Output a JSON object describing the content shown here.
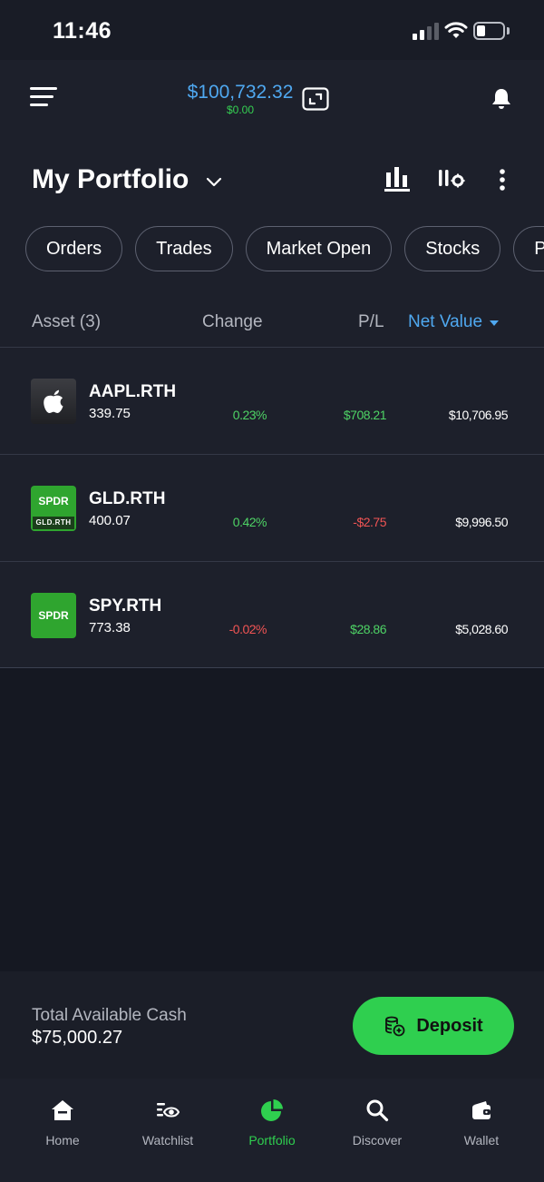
{
  "status_bar": {
    "time": "11:46"
  },
  "header": {
    "balance": "$100,732.32",
    "balance_change": "$0.00",
    "title": "My Portfolio"
  },
  "filters": [
    "Orders",
    "Trades",
    "Market Open",
    "Stocks",
    "P"
  ],
  "columns": {
    "asset": "Asset (3)",
    "change": "Change",
    "pl": "P/L",
    "net_value": "Net Value"
  },
  "assets": [
    {
      "ticker": "AAPL.RTH",
      "price": "339.75",
      "change": "0.23%",
      "change_dir": "pos",
      "pl": "$708.21",
      "pl_dir": "pos",
      "net_value": "$10,706.95",
      "logo": "apple-logo-icon"
    },
    {
      "ticker": "GLD.RTH",
      "price": "400.07",
      "change": "0.42%",
      "change_dir": "pos",
      "pl": "-$2.75",
      "pl_dir": "neg",
      "net_value": "$9,996.50",
      "logo": "spdr-gld-logo",
      "logo_text": "SPDR",
      "logo_sub": "GLD.RTH"
    },
    {
      "ticker": "SPY.RTH",
      "price": "773.38",
      "change": "-0.02%",
      "change_dir": "neg",
      "pl": "$28.86",
      "pl_dir": "pos",
      "net_value": "$5,028.60",
      "logo": "spdr-logo",
      "logo_text": "SPDR"
    }
  ],
  "cash": {
    "label": "Total Available Cash",
    "value": "$75,000.27",
    "deposit_label": "Deposit"
  },
  "nav": [
    {
      "label": "Home",
      "icon": "home-icon"
    },
    {
      "label": "Watchlist",
      "icon": "watchlist-icon"
    },
    {
      "label": "Portfolio",
      "icon": "pie-chart-icon",
      "active": true
    },
    {
      "label": "Discover",
      "icon": "search-icon"
    },
    {
      "label": "Wallet",
      "icon": "wallet-icon"
    }
  ],
  "colors": {
    "accent_blue": "#4fa8f0",
    "positive": "#4ed365",
    "negative": "#f05454",
    "primary_green": "#2fcf4f"
  }
}
